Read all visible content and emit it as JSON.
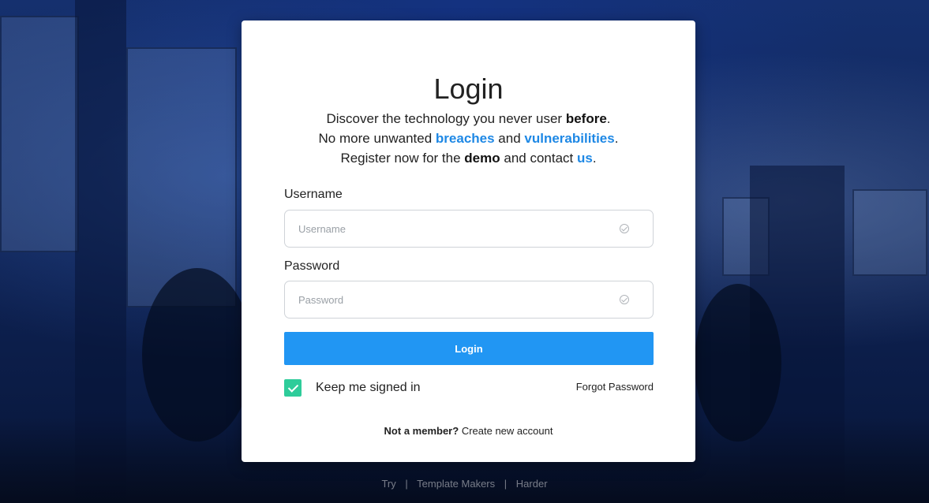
{
  "login": {
    "title": "Login",
    "intro": {
      "line1_a": "Discover the technology you never user ",
      "line1_b": "before",
      "line1_c": ".",
      "line2_a": "No more unwanted ",
      "line2_b": "breaches",
      "line2_c": " and ",
      "line2_d": "vulnerabilities",
      "line2_e": ".",
      "line3_a": "Register now for the ",
      "line3_b": "demo",
      "line3_c": " and contact ",
      "line3_d": "us",
      "line3_e": "."
    },
    "username": {
      "label": "Username",
      "placeholder": "Username",
      "value": ""
    },
    "password": {
      "label": "Password",
      "placeholder": "Password",
      "value": ""
    },
    "submit_label": "Login",
    "keep_signed_in": {
      "label": "Keep me signed in",
      "checked": true
    },
    "forgot_label": "Forgot Password",
    "member_prompt": "Not a member?",
    "create_account_label": "Create new account"
  },
  "footer": {
    "links": [
      "Try",
      "Template Makers",
      "Harder"
    ],
    "separator": "|"
  },
  "colors": {
    "accent": "#2196f3",
    "link": "#1e88e5",
    "checkbox": "#2ecc9a",
    "background": "#0f2458"
  }
}
